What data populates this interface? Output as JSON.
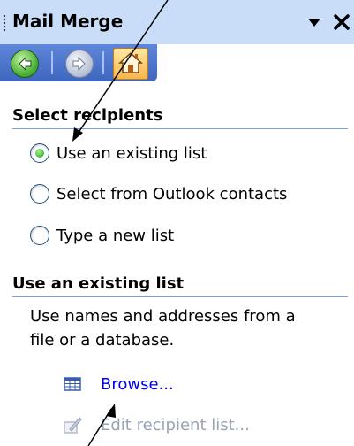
{
  "pane": {
    "title": "Mail Merge",
    "dropdown_icon": "triangle-down-icon",
    "close_icon": "close-x-icon"
  },
  "nav": {
    "back_icon": "back-arrow-icon",
    "forward_icon": "forward-arrow-icon",
    "home_icon": "home-icon"
  },
  "select_recipients": {
    "heading": "Select recipients",
    "options": [
      {
        "label": "Use an existing list",
        "selected": true
      },
      {
        "label": "Select from Outlook contacts",
        "selected": false
      },
      {
        "label": "Type a new list",
        "selected": false
      }
    ]
  },
  "existing_list": {
    "heading": "Use an existing list",
    "description_line1": "Use names and addresses from a",
    "description_line2": "file or a database.",
    "browse_label": "Browse...",
    "browse_icon": "table-icon",
    "edit_label": "Edit recipient list...",
    "edit_icon": "edit-pencil-icon",
    "edit_enabled": false
  },
  "colors": {
    "title_bar": "#c9dcf8",
    "nav_toolbar": "#4a72cc",
    "section_rule": "#7c9fd8",
    "link": "#0000ee",
    "disabled_text": "#9aa3b5",
    "radio_selected": "#21a121"
  }
}
